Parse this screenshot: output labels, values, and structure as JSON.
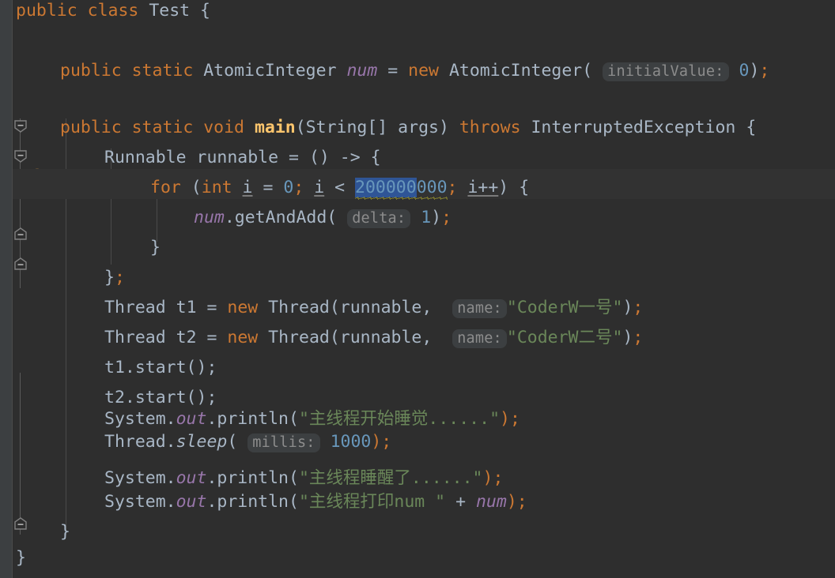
{
  "editor": {
    "theme": "darcula",
    "background": "#2e2e2e",
    "gutter_background": "#2e2e2e",
    "strip_background": "#3c3f41",
    "caret_line_background": "#323232",
    "selection_color": "#2f5596",
    "warning_squiggle_color": "#bbb529",
    "default_text_color": "#a9b7c6",
    "keyword_color": "#cc7832",
    "string_color": "#6a8759",
    "number_color": "#6897bb",
    "field_color": "#9876aa",
    "method_color": "#ffc66d",
    "hint_text_color": "#8c8c8c",
    "hint_chip_color": "#3c3f41",
    "bulb_color": "#e8a33d",
    "language": "Java"
  },
  "code": {
    "class_declaration": {
      "modifier": "public",
      "kind": "class",
      "name": "Test",
      "open_brace": "{"
    },
    "field": {
      "modifiers": "public static",
      "type": "AtomicInteger",
      "name": "num",
      "assign": "=",
      "new_keyword": "new",
      "ctor": "AtomicInteger",
      "hint": "initialValue:",
      "value": "0"
    },
    "main_method": {
      "modifiers": "public static void",
      "name": "main",
      "params": "(String[] args)",
      "throws_keyword": "throws",
      "exception": "InterruptedException",
      "open_brace": "{"
    },
    "runnable": {
      "type": "Runnable",
      "name": "runnable",
      "assign": "=",
      "lambda": "() -> {"
    },
    "for_loop": {
      "keyword": "for",
      "init_type": "int",
      "init_var": "i",
      "init_value": "0",
      "cond_var": "i",
      "cond_op": "<",
      "limit": "200000000",
      "selected_part": "200000",
      "unselected_part": "000",
      "increment": "i++",
      "open_brace": "{"
    },
    "add_call": {
      "receiver": "num",
      "method": ".getAndAdd",
      "hint": "delta:",
      "value": "1"
    },
    "threads": [
      {
        "type": "Thread",
        "var": "t1",
        "new_keyword": "new",
        "ctor": "Thread",
        "arg": "runnable,",
        "hint": "name:",
        "string": "\"CoderW一号\""
      },
      {
        "type": "Thread",
        "var": "t2",
        "new_keyword": "new",
        "ctor": "Thread",
        "arg": "runnable,",
        "hint": "name:",
        "string": "\"CoderW二号\""
      }
    ],
    "starts": [
      "t1.start();",
      "t2.start();"
    ],
    "print_before_sleep": {
      "prefix": "System.",
      "field": "out",
      "method": ".println(",
      "string": "\"主线程开始睡觉......\"",
      "suffix": ");"
    },
    "sleep": {
      "type": "Thread.",
      "method": "sleep",
      "open": "(",
      "hint": "millis:",
      "value": "1000",
      "suffix": ");"
    },
    "print_after_sleep": {
      "prefix": "System.",
      "field": "out",
      "method": ".println(",
      "string": "\"主线程睡醒了......\"",
      "suffix": ");"
    },
    "print_num": {
      "prefix": "System.",
      "field": "out",
      "method": ".println(",
      "string": "\"主线程打印num \"",
      "plus": "+",
      "value": "num",
      "suffix": ");"
    },
    "closing_braces": [
      "}",
      "}"
    ]
  },
  "gutter": {
    "fold_markers": [
      {
        "type": "fold-start",
        "direction": "down"
      },
      {
        "type": "fold-start",
        "direction": "down"
      },
      {
        "type": "fold-start",
        "direction": "down"
      },
      {
        "type": "fold-end",
        "direction": "up"
      },
      {
        "type": "fold-end",
        "direction": "up"
      },
      {
        "type": "fold-end",
        "direction": "up"
      }
    ],
    "intention_bulb": "lightbulb-icon"
  }
}
